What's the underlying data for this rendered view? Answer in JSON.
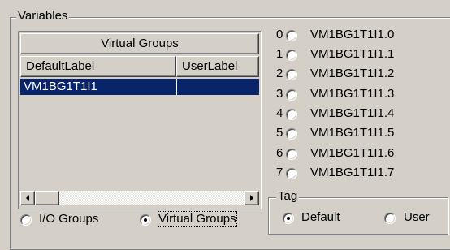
{
  "variables_group": {
    "title": "Variables"
  },
  "list": {
    "title": "Virtual Groups",
    "columns": [
      "DefaultLabel",
      "UserLabel"
    ],
    "rows": [
      {
        "default_label": "VM1BG1T1I1",
        "user_label": ""
      }
    ]
  },
  "group_mode": {
    "options": [
      {
        "label": "I/O Groups",
        "checked": false
      },
      {
        "label": "Virtual Groups",
        "checked": true
      }
    ]
  },
  "bit_options": [
    {
      "index": "0",
      "label": "VM1BG1T1I1.0",
      "checked": false
    },
    {
      "index": "1",
      "label": "VM1BG1T1I1.1",
      "checked": false
    },
    {
      "index": "2",
      "label": "VM1BG1T1I1.2",
      "checked": false
    },
    {
      "index": "3",
      "label": "VM1BG1T1I1.3",
      "checked": false
    },
    {
      "index": "4",
      "label": "VM1BG1T1I1.4",
      "checked": false
    },
    {
      "index": "5",
      "label": "VM1BG1T1I1.5",
      "checked": false
    },
    {
      "index": "6",
      "label": "VM1BG1T1I1.6",
      "checked": false
    },
    {
      "index": "7",
      "label": "VM1BG1T1I1.7",
      "checked": false
    }
  ],
  "tag_group": {
    "title": "Tag",
    "options": [
      {
        "label": "Default",
        "checked": true
      },
      {
        "label": "User",
        "checked": false
      }
    ]
  },
  "colors": {
    "face": "#d4d0c8",
    "selection": "#0a246a",
    "selection_text": "#ffffff"
  }
}
